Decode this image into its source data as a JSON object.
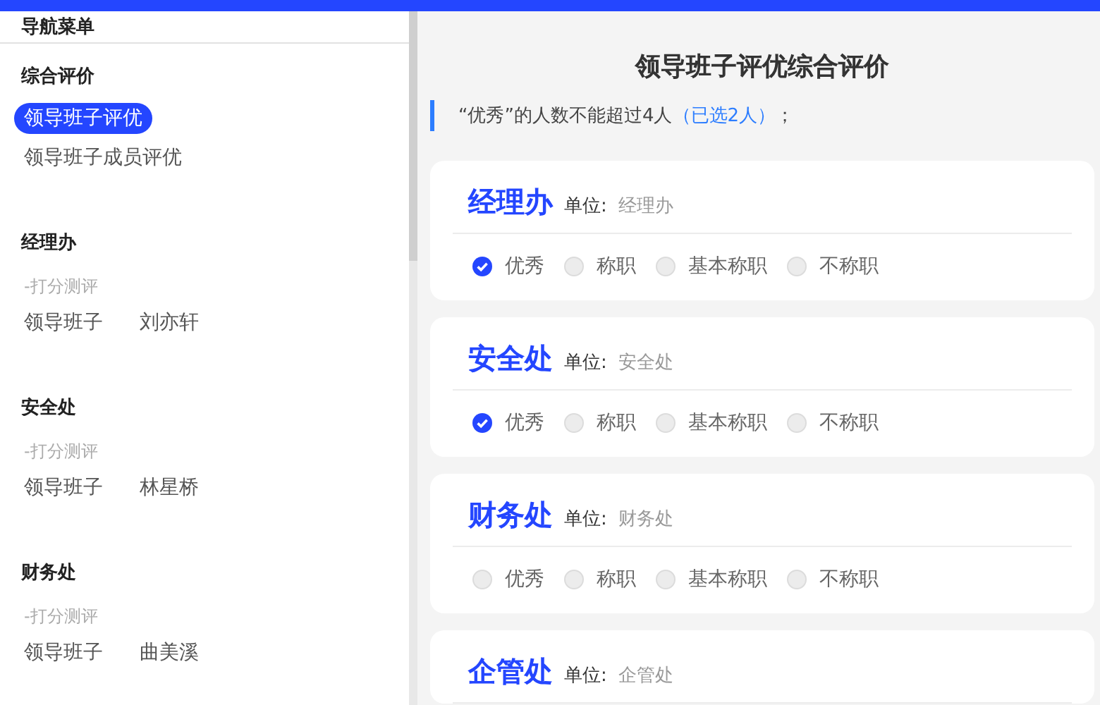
{
  "nav": {
    "title": "导航菜单",
    "sections": [
      {
        "title": "综合评价",
        "kind": "list",
        "items": [
          {
            "label": "领导班子评优",
            "selected": true
          },
          {
            "label": "领导班子成员评优",
            "selected": false
          }
        ]
      },
      {
        "title": "经理办",
        "kind": "scoring",
        "subtitle": "-打分测评",
        "items": [
          {
            "label": "领导班子",
            "selected": false
          },
          {
            "label": "刘亦轩",
            "selected": false
          }
        ]
      },
      {
        "title": "安全处",
        "kind": "scoring",
        "subtitle": "-打分测评",
        "items": [
          {
            "label": "领导班子",
            "selected": false
          },
          {
            "label": "林星桥",
            "selected": false
          }
        ]
      },
      {
        "title": "财务处",
        "kind": "scoring",
        "subtitle": "-打分测评",
        "items": [
          {
            "label": "领导班子",
            "selected": false
          },
          {
            "label": "曲美溪",
            "selected": false
          }
        ]
      }
    ]
  },
  "main": {
    "title": "领导班子评优综合评价",
    "notice": {
      "text": "“优秀”的人数不能超过4人",
      "highlight": "（已选2人）",
      "end": "；"
    },
    "cards": [
      {
        "name": "经理办",
        "unit_label": "单位:",
        "unit_value": "经理办",
        "options": [
          {
            "label": "优秀",
            "selected": true
          },
          {
            "label": "称职",
            "selected": false
          },
          {
            "label": "基本称职",
            "selected": false
          },
          {
            "label": "不称职",
            "selected": false
          }
        ]
      },
      {
        "name": "安全处",
        "unit_label": "单位:",
        "unit_value": "安全处",
        "options": [
          {
            "label": "优秀",
            "selected": true
          },
          {
            "label": "称职",
            "selected": false
          },
          {
            "label": "基本称职",
            "selected": false
          },
          {
            "label": "不称职",
            "selected": false
          }
        ]
      },
      {
        "name": "财务处",
        "unit_label": "单位:",
        "unit_value": "财务处",
        "options": [
          {
            "label": "优秀",
            "selected": false
          },
          {
            "label": "称职",
            "selected": false
          },
          {
            "label": "基本称职",
            "selected": false
          },
          {
            "label": "不称职",
            "selected": false
          }
        ]
      },
      {
        "name": "企管处",
        "unit_label": "单位:",
        "unit_value": "企管处"
      }
    ]
  }
}
